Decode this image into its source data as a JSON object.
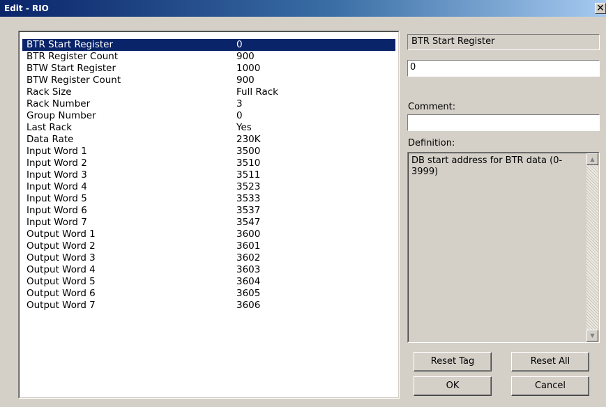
{
  "window": {
    "title": "Edit - RIO",
    "close_glyph": "✕"
  },
  "properties": [
    {
      "name": "BTR Start Register",
      "value": "0"
    },
    {
      "name": "BTR Register Count",
      "value": "900"
    },
    {
      "name": "BTW Start Register",
      "value": "1000"
    },
    {
      "name": "BTW Register Count",
      "value": "900"
    },
    {
      "name": "Rack Size",
      "value": "Full Rack"
    },
    {
      "name": "Rack Number",
      "value": "3"
    },
    {
      "name": "Group Number",
      "value": "0"
    },
    {
      "name": "Last Rack",
      "value": "Yes"
    },
    {
      "name": "Data Rate",
      "value": "230K"
    },
    {
      "name": "Input Word 1",
      "value": "3500"
    },
    {
      "name": "Input Word 2",
      "value": "3510"
    },
    {
      "name": "Input Word 3",
      "value": "3511"
    },
    {
      "name": "Input Word 4",
      "value": "3523"
    },
    {
      "name": "Input Word 5",
      "value": "3533"
    },
    {
      "name": "Input Word 6",
      "value": "3537"
    },
    {
      "name": "Input Word 7",
      "value": "3547"
    },
    {
      "name": "Output Word 1",
      "value": "3600"
    },
    {
      "name": "Output Word 2",
      "value": "3601"
    },
    {
      "name": "Output Word 3",
      "value": "3602"
    },
    {
      "name": "Output Word 4",
      "value": "3603"
    },
    {
      "name": "Output Word 5",
      "value": "3604"
    },
    {
      "name": "Output Word 6",
      "value": "3605"
    },
    {
      "name": "Output Word 7",
      "value": "3606"
    }
  ],
  "selected_index": 0,
  "editor": {
    "field_name": "BTR Start Register",
    "value": "0",
    "comment_label": "Comment:",
    "comment_value": "",
    "definition_label": "Definition:",
    "definition_text": "DB start address for BTR data (0-3999)"
  },
  "icons": {
    "scroll_up": "scroll-up-arrow-icon",
    "scroll_down": "scroll-down-arrow-icon"
  },
  "buttons": {
    "reset_tag": "Reset Tag",
    "reset_all": "Reset All",
    "ok": "OK",
    "cancel": "Cancel"
  }
}
